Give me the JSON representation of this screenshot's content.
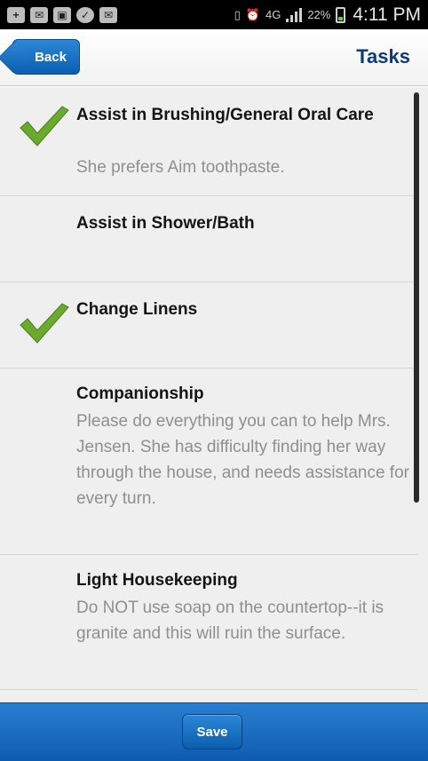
{
  "status_bar": {
    "time": "4:11 PM",
    "battery": "22%",
    "network": "4G",
    "icons": [
      "add-icon",
      "mail-icon",
      "image-icon",
      "check-icon",
      "mail-icon",
      "vibrate-icon",
      "alarm-icon",
      "network-4g-icon",
      "signal-icon",
      "battery-icon"
    ]
  },
  "header": {
    "back_label": "Back",
    "title": "Tasks"
  },
  "tasks": [
    {
      "title": "Assist in Brushing/General Oral Care",
      "note": "She prefers Aim toothpaste.",
      "completed": true
    },
    {
      "title": "Assist in Shower/Bath",
      "note": "",
      "completed": false
    },
    {
      "title": "Change Linens",
      "note": "",
      "completed": true
    },
    {
      "title": "Companionship",
      "note": "Please do everything you can to help Mrs. Jensen. She has difficulty finding her way through the house, and needs assistance for every turn.",
      "completed": false
    },
    {
      "title": "Light Housekeeping",
      "note": "Do NOT use soap on the countertop--it is granite and this will ruin the surface.",
      "completed": false
    }
  ],
  "footer": {
    "save_label": "Save"
  },
  "colors": {
    "accent": "#0b5fb0",
    "title": "#0d3a78",
    "check": "#6aab2e"
  }
}
